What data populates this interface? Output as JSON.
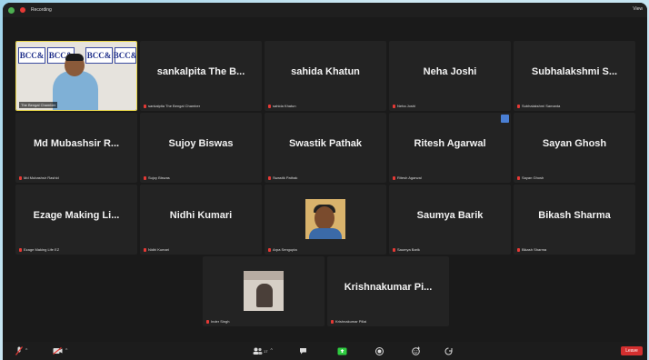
{
  "titlebar": {
    "recording_label": "Recording",
    "view_label": "View"
  },
  "speaker": {
    "name": "The Bengal Chamber",
    "banner_text": "BCC&"
  },
  "tiles": [
    {
      "display": "sankalpita The B...",
      "label": "sankalpita The Bengal Chamber"
    },
    {
      "display": "sahida Khatun",
      "label": "sahida Khatun"
    },
    {
      "display": "Neha Joshi",
      "label": "Neha Joshi"
    },
    {
      "display": "Subhalakshmi S...",
      "label": "Subhalakshmi Samanta"
    },
    {
      "display": "Md Mubashsir R...",
      "label": "Md Mubashsir Rashid"
    },
    {
      "display": "Sujoy Biswas",
      "label": "Sujoy Biswas"
    },
    {
      "display": "Swastik Pathak",
      "label": "Swastik Pathak"
    },
    {
      "display": "Ritesh Agarwal",
      "label": "Ritesh Agarwal"
    },
    {
      "display": "Sayan Ghosh",
      "label": "Sayan Ghosh"
    },
    {
      "display": "Ezage Making Li...",
      "label": "Ezage Making Life EZ"
    },
    {
      "display": "Nidhi Kumari",
      "label": "Nidhi Kumari"
    },
    {
      "display": "",
      "label": "Arpa Sengupta"
    },
    {
      "display": "Saumya Barik",
      "label": "Saumya Barik"
    },
    {
      "display": "Bikash Sharma",
      "label": "Bikash Sharma"
    },
    {
      "display": "",
      "label": "Inder Singh"
    },
    {
      "display": "Krishnakumar Pi...",
      "label": "Krishnakumar Pillai"
    }
  ],
  "toolbar": {
    "participants_count": "17",
    "leave_label": "Leave"
  },
  "colors": {
    "accent_green": "#2ecc40",
    "leave_red": "#d32f2f",
    "speaker_border": "#e8d64a"
  }
}
